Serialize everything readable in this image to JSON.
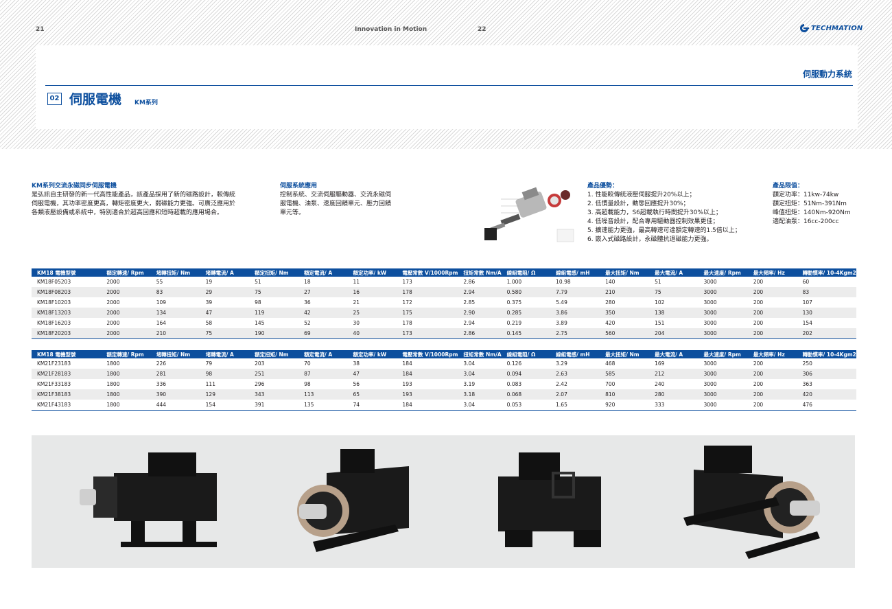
{
  "header": {
    "page_left": "21",
    "page_right": "22",
    "tagline": "Innovation in Motion",
    "logo_text": "TECHMATION",
    "section": "伺服動力系統",
    "chapter_number": "02",
    "chapter_title": "伺服電機",
    "chapter_series": "KM系列"
  },
  "intro": {
    "title": "KM系列交流永磁同步伺服電機",
    "lines": [
      "是弘訊自主研發的新一代高性能產品，該產品採用了新的磁路設計，較傳統",
      "伺服電機，其功率密度更高，轉矩密度更大，弱磁能力更強。可廣泛應用於",
      "各類液壓設備或系統中，特別適合於超高回應和短時超載的應用場合。"
    ]
  },
  "application": {
    "title": "伺服系統應用",
    "lines": [
      "控制系統、交流伺服驅動器、交流永磁伺",
      "服電機、油泵、速度回饋單元、壓力回饋",
      "單元等。"
    ]
  },
  "advantages": {
    "title": "產品優勢：",
    "lines": [
      "1. 性能較傳統液壓伺服提升20%以上；",
      "2. 低慣量設計，動態回應提升30%；",
      "3. 高超載能力，S6超載執行時間提升30%以上；",
      "4. 低噪音設計，配合專用驅動器控制效果更佳；",
      "5. 擴速能力更強，最高轉速可達額定轉速的1.5倍以上；",
      "6. 嵌入式磁路設計，永磁體抗退磁能力更強。"
    ]
  },
  "limits": {
    "title": "產品限值：",
    "lines": [
      "額定功率：11kw-74kw",
      "額定扭矩：51Nm-391Nm",
      "峰值扭矩：140Nm-920Nm",
      "適配油泵：16cc-200cc"
    ]
  },
  "table1": {
    "headers": [
      "KM18 電機型號",
      "額定轉速/ Rpm",
      "堵轉扭矩/ Nm",
      "堵轉電流/ A",
      "額定扭矩/ Nm",
      "額定電流/ A",
      "額定功率/ kW",
      "電壓常數 V/1000Rpm",
      "扭矩常數 Nm/A",
      "線組電阻/ Ω",
      "線組電感/ mH",
      "最大扭矩/ Nm",
      "最大電流/ A",
      "最大速度/ Rpm",
      "最大頻率/ Hz",
      "轉動慣率/ 10-4Kgm2"
    ],
    "rows": [
      [
        "KM18F05203",
        "2000",
        "55",
        "19",
        "51",
        "18",
        "11",
        "173",
        "2.86",
        "1.000",
        "10.98",
        "140",
        "51",
        "3000",
        "200",
        "60"
      ],
      [
        "KM18F08203",
        "2000",
        "83",
        "29",
        "75",
        "27",
        "16",
        "178",
        "2.94",
        "0.580",
        "7.79",
        "210",
        "75",
        "3000",
        "200",
        "83"
      ],
      [
        "KM18F10203",
        "2000",
        "109",
        "39",
        "98",
        "36",
        "21",
        "172",
        "2.85",
        "0.375",
        "5.49",
        "280",
        "102",
        "3000",
        "200",
        "107"
      ],
      [
        "KM18F13203",
        "2000",
        "134",
        "47",
        "119",
        "42",
        "25",
        "175",
        "2.90",
        "0.285",
        "3.86",
        "350",
        "138",
        "3000",
        "200",
        "130"
      ],
      [
        "KM18F16203",
        "2000",
        "164",
        "58",
        "145",
        "52",
        "30",
        "178",
        "2.94",
        "0.219",
        "3.89",
        "420",
        "151",
        "3000",
        "200",
        "154"
      ],
      [
        "KM18F20203",
        "2000",
        "210",
        "75",
        "190",
        "69",
        "40",
        "173",
        "2.86",
        "0.145",
        "2.75",
        "560",
        "204",
        "3000",
        "200",
        "202"
      ]
    ]
  },
  "table2": {
    "headers": [
      "KM18 電機型號",
      "額定轉速/ Rpm",
      "堵轉扭矩/ Nm",
      "堵轉電流/ A",
      "額定扭矩/ Nm",
      "額定電流/ A",
      "額定功率/ kW",
      "電壓常數 V/1000Rpm",
      "扭矩常數 Nm/A",
      "線組電阻/ Ω",
      "線組電感/ mH",
      "最大扭矩/ Nm",
      "最大電流/ A",
      "最大速度/ Rpm",
      "最大頻率/ Hz",
      "轉動慣率/ 10-4Kgm2"
    ],
    "rows": [
      [
        "KM21F23183",
        "1800",
        "226",
        "79",
        "203",
        "70",
        "38",
        "184",
        "3.04",
        "0.126",
        "3.29",
        "468",
        "169",
        "3000",
        "200",
        "250"
      ],
      [
        "KM21F28183",
        "1800",
        "281",
        "98",
        "251",
        "87",
        "47",
        "184",
        "3.04",
        "0.094",
        "2.63",
        "585",
        "212",
        "3000",
        "200",
        "306"
      ],
      [
        "KM21F33183",
        "1800",
        "336",
        "111",
        "296",
        "98",
        "56",
        "193",
        "3.19",
        "0.083",
        "2.42",
        "700",
        "240",
        "3000",
        "200",
        "363"
      ],
      [
        "KM21F38183",
        "1800",
        "390",
        "129",
        "343",
        "113",
        "65",
        "193",
        "3.18",
        "0.068",
        "2.07",
        "810",
        "280",
        "3000",
        "200",
        "420"
      ],
      [
        "KM21F43183",
        "1800",
        "444",
        "154",
        "391",
        "135",
        "74",
        "184",
        "3.04",
        "0.053",
        "1.65",
        "920",
        "333",
        "3000",
        "200",
        "476"
      ]
    ]
  },
  "colors": {
    "brand": "#0d4f9e",
    "row_alt": "#ececec"
  }
}
